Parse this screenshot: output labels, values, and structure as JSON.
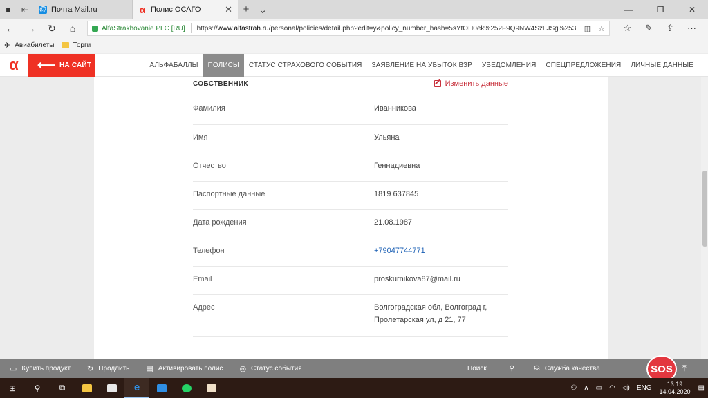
{
  "browser": {
    "tabs": [
      {
        "title": "Почта Mail.ru",
        "favicon": "mail-favicon"
      },
      {
        "title": "Полис ОСАГО",
        "favicon": "alfa-favicon"
      }
    ],
    "address": {
      "org": "AlfaStrakhovanie PLC [RU]",
      "url_prefix": "https://",
      "url_host": "www.alfastrah.ru",
      "url_rest": "/personal/policies/detail.php?edit=y&policy_number_hash=5sYtOH0ek%252F9Q9NW4SzLJSg%253"
    },
    "favorites": [
      {
        "label": "Авиабилеты",
        "icon": "plane-icon"
      },
      {
        "label": "Торги",
        "icon": "folder-icon"
      }
    ]
  },
  "site": {
    "back_label": "НА САЙТ",
    "menu": [
      "Альфабаллы",
      "Полисы",
      "Статус страхового события",
      "Заявление на убыток ВЗР",
      "Уведомления",
      "Спецпредложения",
      "Личные данные"
    ],
    "active_menu_index": 1
  },
  "owner": {
    "title": "СОБСТВЕННИК",
    "edit_label": "Изменить данные",
    "rows": [
      {
        "label": "Фамилия",
        "value": "Иванникова"
      },
      {
        "label": "Имя",
        "value": "Ульяна"
      },
      {
        "label": "Отчество",
        "value": "Геннадиевна"
      },
      {
        "label": "Паспортные данные",
        "value": "1819 637845"
      },
      {
        "label": "Дата рождения",
        "value": "21.08.1987"
      },
      {
        "label": "Телефон",
        "value": "+79047744771"
      },
      {
        "label": "Email",
        "value": "proskurnikova87@mail.ru"
      },
      {
        "label": "Адрес",
        "value_line1": "Волгоградская обл, Волгоград г,",
        "value_line2": "Пролетарская ул, д 21, 77"
      }
    ]
  },
  "bottombar": {
    "items": [
      "Купить продукт",
      "Продлить",
      "Активировать полис",
      "Статус события"
    ],
    "search_placeholder": "Поиск",
    "service": "Служба качества",
    "sos": "SOS"
  },
  "taskbar": {
    "lang": "ENG",
    "time": "13:19",
    "date": "14.04.2020"
  }
}
